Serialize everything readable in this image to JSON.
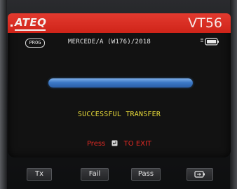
{
  "header": {
    "brand": "ATEQ",
    "model": "VT56"
  },
  "info": {
    "mode_badge": "PROG",
    "vehicle": "MERCEDE/A (W176)/2018",
    "battery_icon": "battery-icon"
  },
  "progress": {
    "value_percent": 100,
    "color": "#3c79c7"
  },
  "status": {
    "message": "SUCCESSFUL TRANSFER",
    "color": "#e9dc3a"
  },
  "exit": {
    "press": "Press",
    "to_exit": "TO EXIT",
    "key_icon": "enter-key-icon",
    "color": "#e02a24"
  },
  "softkeys": [
    {
      "label": "Tx"
    },
    {
      "label": "Fail"
    },
    {
      "label": "Pass"
    },
    {
      "label": "",
      "icon": "battery-key-icon"
    }
  ],
  "colors": {
    "header": "#cf2419",
    "screen_bg": "#121212"
  }
}
